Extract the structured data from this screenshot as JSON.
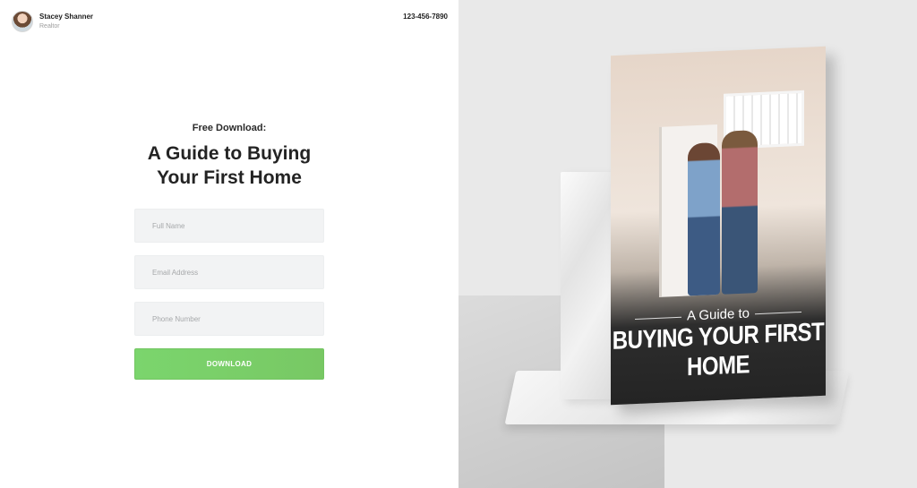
{
  "agent": {
    "name": "Stacey Shanner",
    "role": "Realtor"
  },
  "contact": {
    "phone": "123-456-7890"
  },
  "hero": {
    "kicker": "Free Download:",
    "title_line1": "A Guide to Buying",
    "title_line2": "Your First Home"
  },
  "form": {
    "full_name_placeholder": "Full Name",
    "email_placeholder": "Email Address",
    "phone_placeholder": "Phone Number",
    "submit_label": "DOWNLOAD"
  },
  "book": {
    "subtitle": "A Guide to",
    "title": "BUYING YOUR FIRST HOME"
  },
  "colors": {
    "button": "#78CB67",
    "field": "#F2F3F4",
    "right_bg": "#E9E9E9"
  }
}
